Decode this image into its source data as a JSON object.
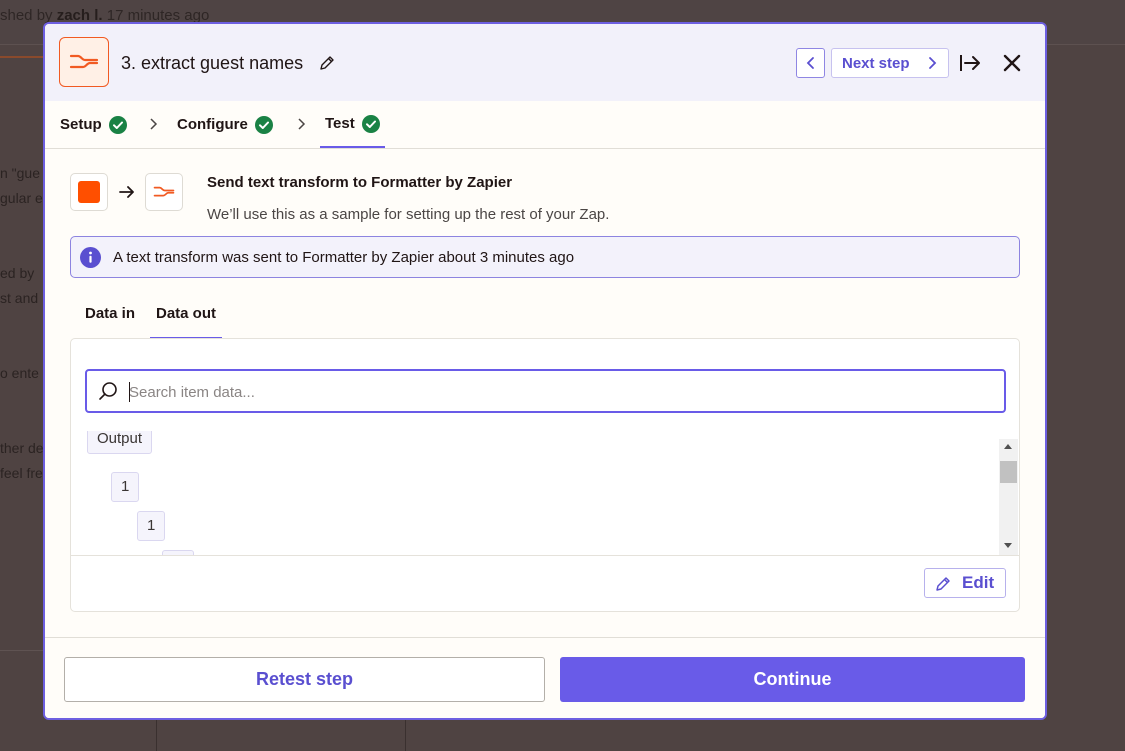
{
  "background": {
    "published_prefix": "shed by ",
    "published_user": "zach l.",
    "published_suffix": " 17 minutes ago",
    "snippets": [
      "n \"gue",
      "gular e",
      "ed by",
      "st and",
      "o ente",
      "ther de",
      "feel fre"
    ]
  },
  "modal": {
    "step_title": "3. extract guest names",
    "nav": {
      "next_label": "Next step"
    },
    "tabs": [
      {
        "label": "Setup"
      },
      {
        "label": "Configure"
      },
      {
        "label": "Test"
      }
    ],
    "flow": {
      "title": "Send text transform to Formatter by Zapier",
      "subtitle": "We’ll use this as a sample for setting up the rest of your Zap."
    },
    "info": {
      "text": "A text transform was sent to Formatter by Zapier about 3 minutes ago"
    },
    "data_tabs": [
      {
        "label": "Data in"
      },
      {
        "label": "Data out"
      }
    ],
    "search": {
      "placeholder": "Search item data..."
    },
    "tree": [
      {
        "label": "Output"
      },
      {
        "label": "1"
      },
      {
        "label": "1"
      }
    ],
    "edit_label": "Edit",
    "footer": {
      "retest_label": "Retest step",
      "continue_label": "Continue"
    }
  },
  "colors": {
    "accent": "#695be8",
    "brand_orange": "#ff4f00",
    "success_green": "#1a8245"
  }
}
